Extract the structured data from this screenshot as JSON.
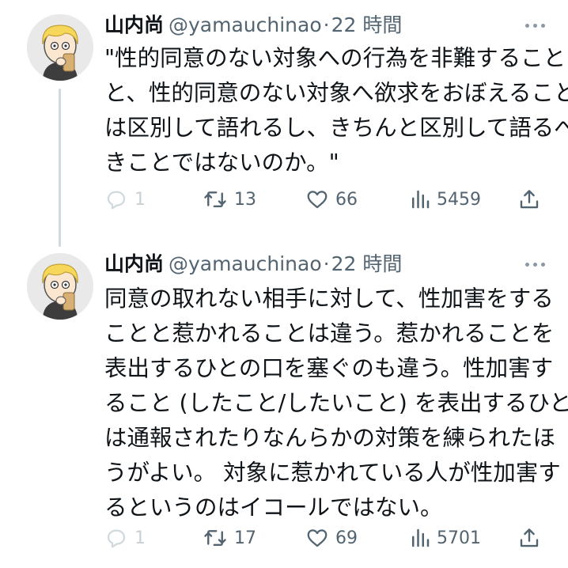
{
  "tweets": [
    {
      "author_name": "山内尚",
      "handle": "@yamauchinao",
      "separator": "·",
      "time": "22 時間",
      "text": "\"性的同意のない対象への行為を非難すること\nと、性的同意のない対象へ欲求をおぼえること\nは区別して語れるし、きちんと区別して語るべ\nきことではないのか。\"",
      "replies": "1",
      "retweets": "13",
      "likes": "66",
      "views": "5459"
    },
    {
      "author_name": "山内尚",
      "handle": "@yamauchinao",
      "separator": "·",
      "time": "22 時間",
      "text": "同意の取れない相手に対して、性加害をする\nことと惹かれることは違う。惹かれることを\n表出するひとの口を塞ぐのも違う。性加害す\nること (したこと/したいこと) を表出するひと\nは通報されたりなんらかの対策を練られたほ\nうがよい。 対象に惹かれている人が性加害す\nるというのはイコールではない。",
      "replies": "1",
      "retweets": "17",
      "likes": "69",
      "views": "5701"
    }
  ],
  "icons": {
    "avatar": "blonde-character-drinking-avatar",
    "more": "more-dots-icon",
    "reply": "reply-bubble-icon",
    "retweet": "retweet-icon",
    "like": "heart-icon",
    "views": "views-bars-icon",
    "share": "share-upload-icon"
  },
  "colors": {
    "text": "#0f1419",
    "secondary": "#536471",
    "thread_line": "#cfd9de"
  }
}
